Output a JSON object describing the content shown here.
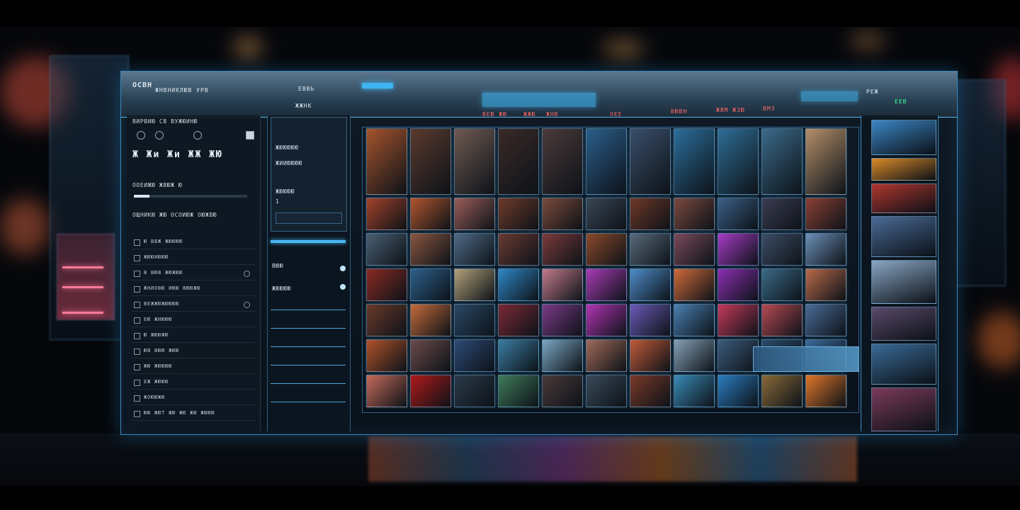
{
  "titlebar": {
    "logo_text": "ОСВН",
    "tab_a": "ЖНВНИКЛЮВ УРВ",
    "tab_b": "ЖЖНК",
    "tab_c": "ЕВВЬ",
    "menu": [
      "ВЕЮ ЖЮ",
      "ЖЖЮ",
      "ЖНВ",
      "ОЕЕ",
      "ВЮВН",
      "ЖВМ ЖЗЮ",
      "ВМЗ"
    ],
    "right_badge_a": "РЕЖ",
    "right_badge_b": "ЕЕВ"
  },
  "sidebar": {
    "header": "ВИРВИЮ СВ ВУЖЮИНЮ",
    "title": "Ж Жи Жи ЖЖ ЖЮ",
    "section_label": "ООЕИЖЮ ЖВЮЖ Ю",
    "section_title": "ОЩНИКЮ ЖЮ ОСОИЮЖ ОЮЖВЮ",
    "items": [
      {
        "label": "Ю ВВЖ ЖЮЮЮЮ"
      },
      {
        "label": "ЖЮЮИЮЮЮ"
      },
      {
        "label": "В ВЮВ ЖЮЖЮЮ"
      },
      {
        "label": "ЖНИОВЮ ИЮЮ ВЮЮЖЮ"
      },
      {
        "label": "ВЕЖЖЮЖЮЮЮЮ"
      },
      {
        "label": "ЕЮ ЖИЮЮЮ"
      },
      {
        "label": "Ю ЖЮЮЖЮ"
      },
      {
        "label": "ЮВ ВЮЮ ЖЮЮ"
      },
      {
        "label": "ЖЮ ЖЮЮЮЮ"
      },
      {
        "label": "ЕЖ ЖЮЮЮ"
      },
      {
        "label": "ЖОЮЮЖЮ"
      },
      {
        "label": "ЮЮ ЖЮТ ЖЮ ЖЮ ЖЮ ЖЮЮЮ"
      }
    ]
  },
  "midcol": {
    "box_a_title": "ЖЮЮЮЮЮ",
    "box_a_sub": "ЖИИЮЮЮЮ",
    "box_a_val": "ЖЮЮЮЮ",
    "box_a_num": "1",
    "box_b_label": "ВЮЮ",
    "box_b_sub": "ЖЮЮЮЮ"
  },
  "grid": {
    "rows": [
      [
        "#a4532d",
        "#5a3a2e",
        "#6f5a52",
        "#3a2a28",
        "#4b3a3a",
        "#2a5f8a",
        "#3a4f6a",
        "#2b6d9a",
        "#2e6d95",
        "#3a6a8a",
        "#b38e6a"
      ],
      [
        "#a3422a",
        "#b2552e",
        "#9a5e58",
        "#6e3a2a",
        "#7a4a3a",
        "#3a4655",
        "#6e3828",
        "#7a4a3f",
        "#3a5f86",
        "#3b3d52",
        "#8a3f35"
      ],
      [
        "#4a5f72",
        "#8a5540",
        "#4f6a86",
        "#6a3a32",
        "#7a3a3a",
        "#8a4a2a",
        "#59697a",
        "#7a4a5a",
        "#a43cc4",
        "#3d4d66",
        "#6b8fb6"
      ],
      [
        "#8a2a22",
        "#2d5f8a",
        "#b3a07a",
        "#2f86c4",
        "#c07a8a",
        "#a83cb4",
        "#4d8cc6",
        "#d06a3a",
        "#8a2fb0",
        "#3a6a86",
        "#b86a4a"
      ],
      [
        "#6a3a2a",
        "#c46a3a",
        "#2a4866",
        "#7a2a36",
        "#7a3a86",
        "#b035b0",
        "#6a5ab6",
        "#4a7fb0",
        "#c43a5a",
        "#b64a52",
        "#4a6a96"
      ],
      [
        "#b0522a",
        "#6a4a4a",
        "#2d4a76",
        "#3a7ca0",
        "#7aa6c4",
        "#a06a5a",
        "#c05a3a",
        "#86a0b6",
        "#3a5a7a",
        "#2a4a6a",
        "#3a6a9a"
      ],
      [
        "#c46a5a",
        "#b01a1a",
        "#2a3a4a",
        "#3f7a5a",
        "#4a3a3a",
        "#3a4a5a",
        "#7a3a2a",
        "#3a8ab6",
        "#2b7cbf",
        "#8a6a3a",
        "#e0762a"
      ]
    ]
  },
  "rightcol": {
    "thumbs": [
      "#3a86c4",
      "#d98a2a",
      "#b0362e",
      "#4a6a96",
      "#8aa6c4",
      "#5a4a6a",
      "#3a6a96",
      "#7a3a5a"
    ]
  }
}
